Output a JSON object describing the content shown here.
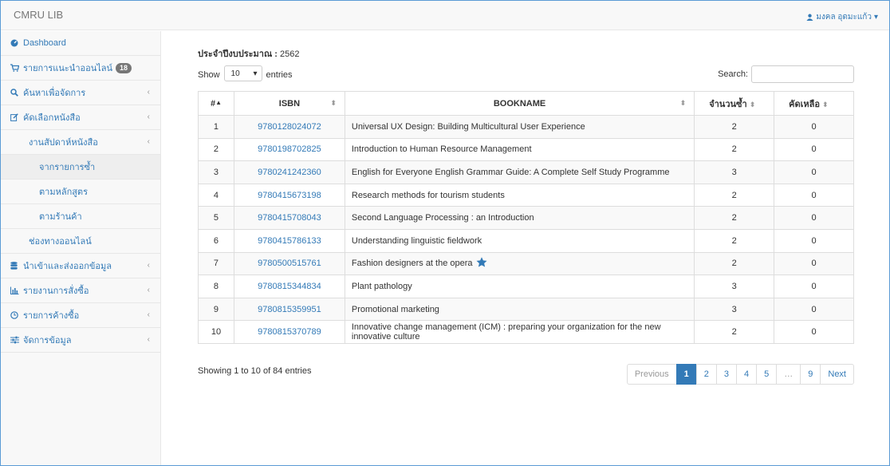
{
  "app": {
    "brand": "CMRU LIB",
    "user": "มงคล อุดมะแก้ว"
  },
  "sidebar": {
    "items": [
      {
        "label": "Dashboard"
      },
      {
        "label": "รายการแนะนำออนไลน์",
        "badge": "18"
      },
      {
        "label": "ค้นหาเพื่อจัดการ"
      },
      {
        "label": "คัดเลือกหนังสือ"
      },
      {
        "label": "งานสัปดาห์หนังสือ"
      },
      {
        "label": "จากรายการซ้ำ"
      },
      {
        "label": "ตามหลักสูตร"
      },
      {
        "label": "ตามร้านค้า"
      },
      {
        "label": "ช่องทางออนไลน์"
      },
      {
        "label": "นำเข้าและส่งออกข้อมูล"
      },
      {
        "label": "รายงานการสั่งซื้อ"
      },
      {
        "label": "รายการค้างซื้อ"
      },
      {
        "label": "จัดการข้อมูล"
      }
    ]
  },
  "main": {
    "fiscal_label": "ประจำปีงบประมาณ :",
    "fiscal_value": "2562",
    "show_label": "Show",
    "entries_value": "10",
    "entries_label": "entries",
    "search_label": "Search:",
    "search_value": "",
    "columns": [
      "#",
      "ISBN",
      "BOOKNAME",
      "จำนวนซ้ำ",
      "คัดเหลือ"
    ],
    "rows": [
      {
        "n": "1",
        "isbn": "9780128024072",
        "name": "Universal UX Design: Building Multicultural User Experience",
        "dup": "2",
        "left": "0"
      },
      {
        "n": "2",
        "isbn": "9780198702825",
        "name": "Introduction to Human Resource Management",
        "dup": "2",
        "left": "0"
      },
      {
        "n": "3",
        "isbn": "9780241242360",
        "name": "English for Everyone English Grammar Guide: A Complete Self Study Programme",
        "dup": "3",
        "left": "0"
      },
      {
        "n": "4",
        "isbn": "9780415673198",
        "name": "Research methods for tourism students",
        "dup": "2",
        "left": "0"
      },
      {
        "n": "5",
        "isbn": "9780415708043",
        "name": "Second Language Processing : an Introduction",
        "dup": "2",
        "left": "0"
      },
      {
        "n": "6",
        "isbn": "9780415786133",
        "name": "Understanding linguistic fieldwork",
        "dup": "2",
        "left": "0"
      },
      {
        "n": "7",
        "isbn": "9780500515761",
        "name": "Fashion designers at the opera",
        "dup": "2",
        "left": "0",
        "star": true
      },
      {
        "n": "8",
        "isbn": "9780815344834",
        "name": "Plant pathology",
        "dup": "3",
        "left": "0"
      },
      {
        "n": "9",
        "isbn": "9780815359951",
        "name": "Promotional marketing",
        "dup": "3",
        "left": "0"
      },
      {
        "n": "10",
        "isbn": "9780815370789",
        "name": "Innovative change management (ICM) : preparing your organization for the new innovative culture",
        "dup": "2",
        "left": "0"
      }
    ],
    "info": "Showing 1 to 10 of 84 entries",
    "pager": [
      "Previous",
      "1",
      "2",
      "3",
      "4",
      "5",
      "…",
      "9",
      "Next"
    ]
  },
  "colors": {
    "link": "#337ab7",
    "star": "#337ab7",
    "badge": "#777777"
  }
}
